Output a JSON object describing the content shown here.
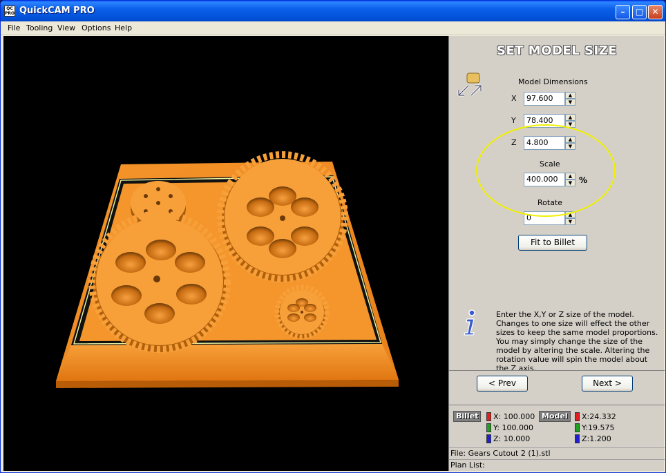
{
  "window": {
    "title": "QuickCAM PRO",
    "app_icon_text": "QC PRO"
  },
  "menu": [
    "File",
    "Tooling",
    "View",
    "Options",
    "Help"
  ],
  "panel": {
    "title": "SET MODEL SIZE",
    "model_dimensions_label": "Model Dimensions",
    "x_label": "X",
    "y_label": "Y",
    "z_label": "Z",
    "x_value": "97.600",
    "y_value": "78.400",
    "z_value": "4.800",
    "scale_label": "Scale",
    "scale_value": "400.000",
    "scale_unit": "%",
    "rotate_label": "Rotate",
    "rotate_value": "0",
    "fit_button": "Fit to Billet",
    "info_text": "Enter the X,Y or Z size of the model. Changes to one size will effect the other sizes to keep the same model proportions. You may simply change the size of the model by altering the scale. Altering the rotation value will spin the model about the Z axis.",
    "prev_button": "< Prev",
    "next_button": "Next >"
  },
  "summary": {
    "billet_label": "Billet",
    "model_label": "Model",
    "billet_x": "X: 100.000",
    "billet_y": "Y: 100.000",
    "billet_z": "Z: 10.000",
    "model_x": "X:24.332",
    "model_y": "Y:19.575",
    "model_z": "Z:1.200"
  },
  "status": {
    "file": "File: Gears Cutout 2 (1).stl",
    "plan_list": "Plan List:"
  },
  "colors": {
    "billet_orange": "#f08a1e",
    "highlight_yellow": "#f0f000",
    "swatch_x": "#e02020",
    "swatch_y": "#20a020",
    "swatch_z": "#2020d0"
  }
}
